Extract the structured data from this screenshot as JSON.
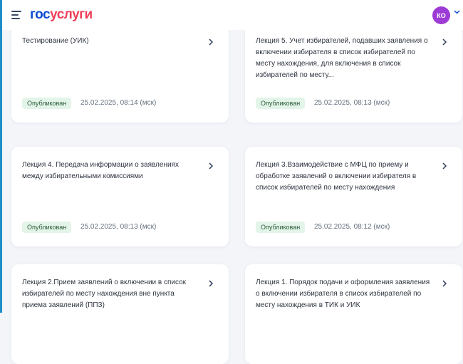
{
  "header": {
    "logo_part1": "гос",
    "logo_part2": "услуги",
    "avatar_initials": "КО",
    "accent_color": "#0d4cd3",
    "brand_red": "#ee3f58"
  },
  "cards": [
    {
      "title": "Тестирование (УИК)",
      "status": "Опубликован",
      "date": "25.02.2025, 08:14 (мск)"
    },
    {
      "title": "Лекция 5. Учет избирателей, подавших заявления о включении избирателя в список избирателей по месту нахождения, для включения в список избирателей по месту...",
      "status": "Опубликован",
      "date": "25.02.2025, 08:13 (мск)"
    },
    {
      "title": "Лекция 4. Передача информации о заявлениях между избирательными комиссиями",
      "status": "Опубликован",
      "date": "25.02.2025, 08:13 (мск)"
    },
    {
      "title": "Лекция 3.Взаимодействие с МФЦ по приему и обработке заявлений о включении избирателя в список избирателей по месту нахождения",
      "status": "Опубликован",
      "date": "25.02.2025, 08:12 (мск)"
    },
    {
      "title": "Лекция 2.Прием заявлений о включении в список избирателей по месту нахождения вне пункта приема заявлений (ППЗ)",
      "status": "",
      "date": ""
    },
    {
      "title": "Лекция 1. Порядок подачи и оформления заявления о включении избирателя в список избирателей по месту нахождения в ТИК и УИК",
      "status": "",
      "date": ""
    }
  ]
}
